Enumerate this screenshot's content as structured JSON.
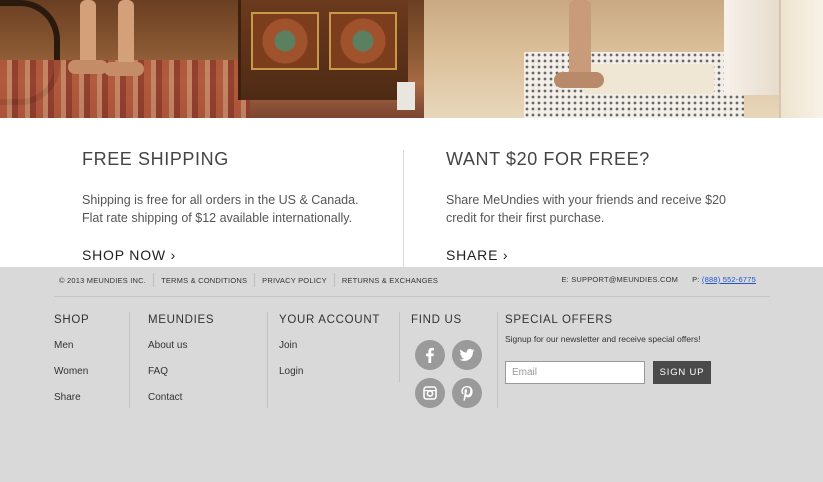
{
  "hero": {
    "left_image": "living-room-feet-photo",
    "right_image": "bathroom-feet-photo"
  },
  "promo": {
    "shipping": {
      "title": "FREE SHIPPING",
      "text": "Shipping is free for all orders in the US & Canada. Flat rate shipping of $12 available internationally.",
      "cta": "SHOP NOW ›"
    },
    "referral": {
      "title": "WANT $20 FOR FREE?",
      "text": "Share MeUndies with your friends and receive $20 credit for their first purchase.",
      "cta": "SHARE ›"
    }
  },
  "footer": {
    "legal": {
      "copyright": "© 2013 MEUNDIES INC.",
      "links": [
        "TERMS & CONDITIONS",
        "PRIVACY POLICY",
        "RETURNS & EXCHANGES"
      ]
    },
    "contact": {
      "email_label": "E: SUPPORT@MEUNDIES.COM",
      "phone_prefix": "P:",
      "phone": "(888) 552-6775"
    },
    "columns": {
      "shop": {
        "heading": "SHOP",
        "links": [
          "Men",
          "Women",
          "Share"
        ]
      },
      "meundies": {
        "heading": "MEUNDIES",
        "links": [
          "About us",
          "FAQ",
          "Contact"
        ]
      },
      "account": {
        "heading": "YOUR ACCOUNT",
        "links": [
          "Join",
          "Login"
        ]
      },
      "find_us": {
        "heading": "FIND US",
        "icons": [
          "facebook-icon",
          "twitter-icon",
          "instagram-icon",
          "pinterest-icon"
        ]
      }
    },
    "offers": {
      "heading": "SPECIAL OFFERS",
      "text": "Signup for our newsletter and receive special offers!",
      "email_placeholder": "Email",
      "button": "SIGN UP"
    }
  },
  "colors": {
    "footer_bg": "#d9d9d9",
    "social_icon_bg": "#9a9a9a",
    "signup_button": "#4a4a4a",
    "phone_link": "#2255cc"
  }
}
